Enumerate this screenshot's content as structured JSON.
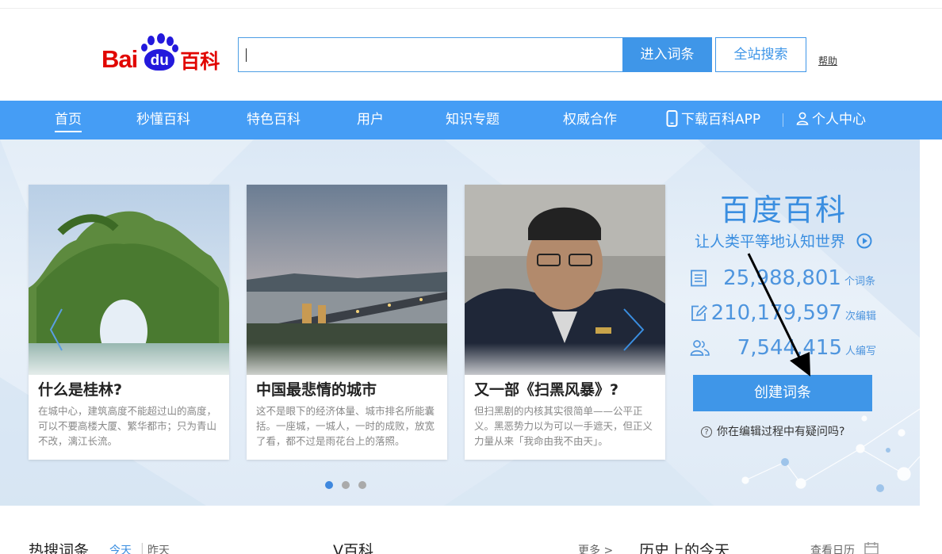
{
  "header": {
    "logo_letters": "Bai",
    "logo_du": "du",
    "logo_baike": "百科",
    "search_placeholder": "",
    "enter_button": "进入词条",
    "site_search_button": "全站搜索",
    "help_link": "帮助"
  },
  "nav": {
    "items": [
      {
        "label": "首页",
        "active": true
      },
      {
        "label": "秒懂百科"
      },
      {
        "label": "特色百科"
      },
      {
        "label": "用户"
      },
      {
        "label": "知识专题"
      },
      {
        "label": "权威合作"
      },
      {
        "label": "下载百科APP",
        "icon": "phone-icon"
      },
      {
        "label": "个人中心",
        "icon": "user-icon"
      }
    ]
  },
  "carousel": {
    "cards": [
      {
        "title": "什么是桂林?",
        "desc": "在城中心，建筑高度不能超过山的高度，可以不要高楼大厦、繁华都市；只为青山不改，漓江长流。"
      },
      {
        "title": "中国最悲情的城市",
        "desc": "这不是眼下的经济体量、城市排名所能囊括。一座城，一城人，一时的成败，放宽了看，都不过是雨花台上的落照。"
      },
      {
        "title": "又一部《扫黑风暴》?",
        "desc": "但扫黑剧的内核其实很简单——公平正义。黑恶势力以为可以一手遮天，但正义力量从来「我命由我不由天」。"
      }
    ],
    "dots": 3,
    "active_dot": 0
  },
  "brand": {
    "title": "百度百科",
    "slogan": "让人类平等地认知世界",
    "stats": [
      {
        "icon": "document-icon",
        "value": "25,988,801",
        "unit": "个词条"
      },
      {
        "icon": "edit-icon",
        "value": "210,179,597",
        "unit": "次编辑"
      },
      {
        "icon": "users-icon",
        "value": "7,544,415",
        "unit": "人编写"
      }
    ],
    "create_button": "创建词条",
    "question": "你在编辑过程中有疑问吗?"
  },
  "bottom": {
    "hot_title": "热搜词条",
    "today": "今天",
    "yesterday": "昨天",
    "v_title": "V百科",
    "more": "更多 >",
    "history_title": "历史上的今天",
    "calendar": "查看日历"
  },
  "colors": {
    "brand_blue": "#3f96e8",
    "nav_blue": "#459df5",
    "logo_red": "#e10601",
    "logo_blue": "#2319dc"
  }
}
